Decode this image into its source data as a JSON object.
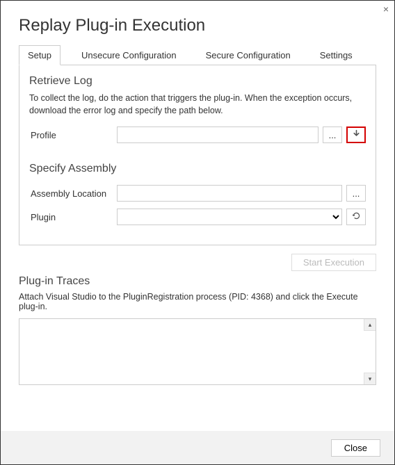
{
  "window": {
    "title": "Replay Plug-in Execution"
  },
  "tabs": {
    "setup": "Setup",
    "unsecure": "Unsecure Configuration",
    "secure": "Secure Configuration",
    "settings": "Settings"
  },
  "setup": {
    "retrieve_title": "Retrieve Log",
    "retrieve_desc": "To collect the log, do the action that triggers the plug-in. When the exception occurs, download the error log and specify the path below.",
    "profile_label": "Profile",
    "profile_value": "",
    "browse_label": "...",
    "specify_title": "Specify Assembly",
    "assembly_label": "Assembly Location",
    "assembly_value": "",
    "browse2_label": "...",
    "plugin_label": "Plugin",
    "plugin_value": ""
  },
  "actions": {
    "start_label": "Start Execution"
  },
  "traces": {
    "title": "Plug-in Traces",
    "desc": "Attach Visual Studio to the PluginRegistration process (PID: 4368) and click the Execute plug-in.",
    "content": ""
  },
  "footer": {
    "close_label": "Close"
  }
}
